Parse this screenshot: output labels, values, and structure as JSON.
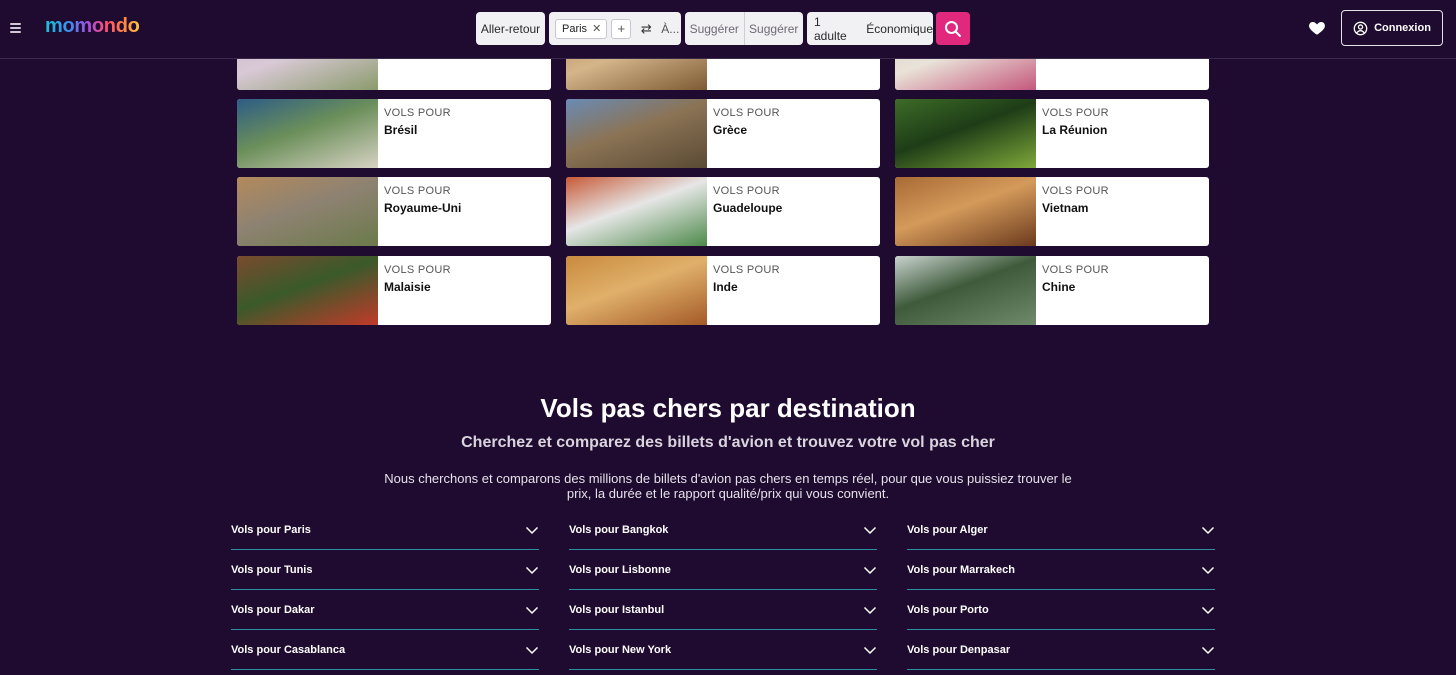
{
  "header": {
    "logo": "momondo",
    "trip_type": "Aller-retour",
    "origin": "Paris",
    "destination_placeholder": "À...",
    "date_depart": "Suggérer",
    "date_return": "Suggérer",
    "passengers": "1 adulte",
    "cabin": "Économique",
    "login_label": "Connexion"
  },
  "cards": [
    {
      "kicker": "",
      "country": "",
      "photo": [
        "#c8b3c7",
        "#8a9b6c",
        "#d9c9d6"
      ]
    },
    {
      "kicker": "",
      "country": "",
      "photo": [
        "#b48a58",
        "#7d5a34",
        "#d4b58a"
      ]
    },
    {
      "kicker": "",
      "country": "",
      "photo": [
        "#d9d2c8",
        "#c4577c",
        "#e9e2d8"
      ]
    },
    {
      "kicker": "VOLS POUR",
      "country": "Brésil",
      "photo": [
        "#2d5c86",
        "#d7d2c3",
        "#6b8f5a"
      ]
    },
    {
      "kicker": "VOLS POUR",
      "country": "Grèce",
      "photo": [
        "#6a8bb5",
        "#5a4a34",
        "#8b7355"
      ]
    },
    {
      "kicker": "VOLS POUR",
      "country": "La Réunion",
      "photo": [
        "#3d6b28",
        "#7ea83a",
        "#1e3d17"
      ]
    },
    {
      "kicker": "VOLS POUR",
      "country": "Royaume-Uni",
      "photo": [
        "#b38a5c",
        "#6b7a4a",
        "#8e8272"
      ]
    },
    {
      "kicker": "VOLS POUR",
      "country": "Guadeloupe",
      "photo": [
        "#c75a38",
        "#4d8a4a",
        "#e6e6e6"
      ]
    },
    {
      "kicker": "VOLS POUR",
      "country": "Vietnam",
      "photo": [
        "#a86a36",
        "#6b3a1e",
        "#d49a5a"
      ]
    },
    {
      "kicker": "VOLS POUR",
      "country": "Malaisie",
      "photo": [
        "#7a4a2e",
        "#c23a2a",
        "#3a5a2a"
      ]
    },
    {
      "kicker": "VOLS POUR",
      "country": "Inde",
      "photo": [
        "#c98a3e",
        "#a45a28",
        "#e0b06a"
      ]
    },
    {
      "kicker": "VOLS POUR",
      "country": "Chine",
      "photo": [
        "#c9d3cf",
        "#6f8a6a",
        "#3e5a3a"
      ]
    }
  ],
  "section": {
    "title": "Vols pas chers par destination",
    "subtitle": "Cherchez et comparez des billets d'avion et trouvez votre vol pas cher",
    "text": "Nous cherchons et comparons des millions de billets d'avion pas chers en temps réel, pour que vous puissiez trouver le prix, la durée et le rapport qualité/prix qui vous convient."
  },
  "destinations": [
    [
      "Vols pour Paris",
      "Vols pour Tunis",
      "Vols pour Dakar",
      "Vols pour Casablanca"
    ],
    [
      "Vols pour Bangkok",
      "Vols pour Lisbonne",
      "Vols pour Istanbul",
      "Vols pour New York"
    ],
    [
      "Vols pour Alger",
      "Vols pour Marrakech",
      "Vols pour Porto",
      "Vols pour Denpasar"
    ]
  ],
  "colors": {
    "background": "#1e0b2f",
    "search_button": "#e0297c",
    "divider": "#2f8fa0"
  }
}
